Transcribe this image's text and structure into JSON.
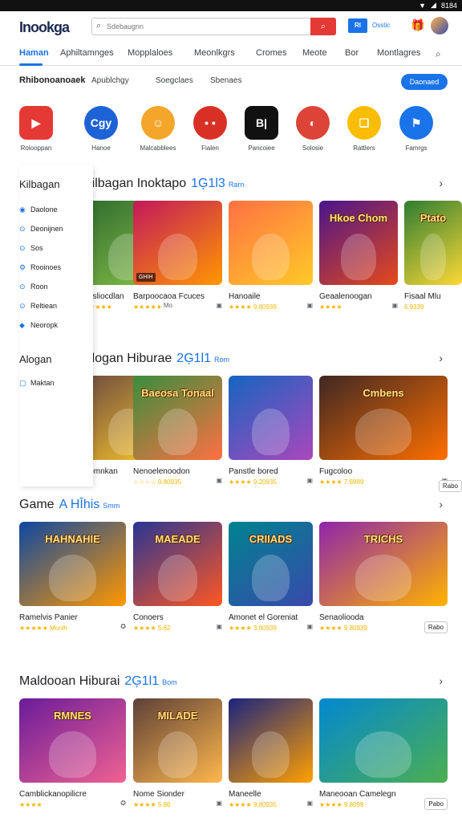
{
  "status": {
    "time": "8184"
  },
  "header": {
    "logo": "Inookga",
    "logo_accent": "#2e7d32",
    "search_placeholder": "Sdebaugnn",
    "partner_tag": "Rl",
    "partner_label": "Osstic",
    "brand_color": "#1a73e8",
    "search_button_color": "#e53935"
  },
  "nav": {
    "tabs": [
      "Haman",
      "Aphiltamnges",
      "Mopplaloes",
      "Meonlkgrs",
      "Cromes",
      "Meote",
      "Bor",
      "Montlagres"
    ]
  },
  "chips": {
    "items": [
      "Rhibonoanoaek",
      "Apublchgy",
      "Soegclaes",
      "Sbenaes"
    ],
    "pill": "Daonaed"
  },
  "apps": [
    {
      "label": "Rolooppan",
      "icon": "play-icon",
      "color": "#e53935",
      "glyph": "▶"
    },
    {
      "label": "Hanoe",
      "icon": "chat-icon",
      "color": "#1e63d6",
      "glyph": "Cgy"
    },
    {
      "label": "Malcabblees",
      "icon": "character-icon",
      "color": "#f4a62a",
      "glyph": "☺"
    },
    {
      "label": "Fialen",
      "icon": "face-icon",
      "color": "#d93025",
      "glyph": "• •"
    },
    {
      "label": "Pancoiee",
      "icon": "box-icon",
      "color": "#111111",
      "glyph": "B|"
    },
    {
      "label": "Solosie",
      "icon": "chrome-icon",
      "color": "#db4437",
      "glyph": "◐"
    },
    {
      "label": "Rattlers",
      "icon": "note-icon",
      "color": "#fbbc04",
      "glyph": "❏"
    },
    {
      "label": "Famrgs",
      "icon": "flag-icon",
      "color": "#1a73e8",
      "glyph": "⚑"
    }
  ],
  "panel": {
    "title1": "Kilbagan",
    "items": [
      {
        "label": "Daolone",
        "icon": "user-icon"
      },
      {
        "label": "Deonijnen",
        "icon": "pin-icon"
      },
      {
        "label": "Sos",
        "icon": "pin-icon"
      },
      {
        "label": "Rooinoes",
        "icon": "gear-icon"
      },
      {
        "label": "Roon",
        "icon": "pin-icon"
      },
      {
        "label": "Reltiean",
        "icon": "pin-icon"
      },
      {
        "label": "Neoropk",
        "icon": "leaf-icon"
      }
    ],
    "title2": "Alogan",
    "item2": "Maktan"
  },
  "sections": [
    {
      "title": "Kilbagan Inoktapo",
      "num": "1Ģ1l3",
      "small": "Rarn",
      "cards": [
        {
          "title": "Fasliocdlan",
          "stars": "★★★★★",
          "meta": "Mo",
          "badge": "",
          "price": "",
          "c1": "#2e6b2e",
          "c2": "#8bc34a"
        },
        {
          "title": "Barpoocaoa Fcuces",
          "stars": "★★★★★",
          "meta": "▣",
          "badge": "GHIH",
          "price": "",
          "c1": "#c2185b",
          "c2": "#ff9800"
        },
        {
          "title": "Hanoaile",
          "stars": "★★★★ 9.80939",
          "meta": "▣",
          "badge": "",
          "price": "",
          "c1": "#ff7043",
          "c2": "#ffca28"
        },
        {
          "title": "Geaalenoogan",
          "stars": "★★★★",
          "meta": "▣",
          "badge": "",
          "price": "",
          "c1": "#4a148c",
          "c2": "#e64a19",
          "tt": "Hkoe Chom"
        },
        {
          "title": "Fisaal Mlu",
          "stars": "6.9339",
          "meta": "",
          "badge": "",
          "price": "",
          "c1": "#2e7d32",
          "c2": "#fdd835",
          "tt": "Ptato"
        }
      ]
    },
    {
      "title": "Alogan Hiburae",
      "num": "2Ģ1l1",
      "small": "Rom",
      "cards": [
        {
          "title": "Nomnkan",
          "stars": "",
          "meta": "",
          "badge": "",
          "price": "",
          "c1": "#6d4c41",
          "c2": "#ffca28"
        },
        {
          "title": "Nenoelenoodon",
          "stars": "☆☆☆☆ 9.80935",
          "meta": "▣",
          "badge": "",
          "price": "",
          "c1": "#388e3c",
          "c2": "#ff7043",
          "tt": "Baeosa Tonaal"
        },
        {
          "title": "Panstle bored",
          "stars": "★★★★ 9.20935",
          "meta": "▣",
          "badge": "",
          "price": "",
          "c1": "#1565c0",
          "c2": "#ab47bc"
        },
        {
          "title": "Fugcoloo",
          "stars": "★★★★ 7.6989",
          "meta": "▣",
          "badge": "",
          "price": "",
          "c1": "#3e2723",
          "c2": "#ff6f00",
          "tt": "Cmbens"
        },
        {
          "title": "",
          "stars": "",
          "meta": "",
          "badge": "",
          "price": "Rabo",
          "c1": "#fff",
          "c2": "#fff"
        }
      ]
    },
    {
      "title": "Game",
      "num": "A HĪhis",
      "small": "Smm",
      "cards": [
        {
          "title": "Ramelvis Panier",
          "stars": "★★★★★ Monlh",
          "meta": "✪",
          "badge": "",
          "price": "",
          "c1": "#0d47a1",
          "c2": "#ff9800",
          "tt": "HAHNAHIE"
        },
        {
          "title": "Conoers",
          "stars": "★★★★ 5.62",
          "meta": "▣",
          "badge": "",
          "price": "",
          "c1": "#283593",
          "c2": "#ff5722",
          "tt": "MAEADE"
        },
        {
          "title": "Amonet el Goreniat",
          "stars": "★★★★ 3.80939",
          "meta": "▣",
          "badge": "",
          "price": "",
          "c1": "#00838f",
          "c2": "#3949ab",
          "tt": "CRIIADS"
        },
        {
          "title": "Senaoliooda",
          "stars": "★★★★ 9.80939",
          "meta": "▣",
          "badge": "",
          "price": "Rabo",
          "c1": "#8e24aa",
          "c2": "#ffb300",
          "tt": "TRICHS"
        }
      ]
    },
    {
      "title": "Maldooan Hiburai",
      "num": "2Ģ1l1",
      "small": "Bom",
      "cards": [
        {
          "title": "Camblickanopilicre",
          "stars": "★★★★",
          "meta": "✪",
          "badge": "",
          "price": "",
          "c1": "#6a1b9a",
          "c2": "#f06292",
          "tt": "RMNES"
        },
        {
          "title": "Nome Sionder",
          "stars": "★★★★ 5.80",
          "meta": "▣",
          "badge": "",
          "price": "",
          "c1": "#5d4037",
          "c2": "#ffb74d",
          "tt": "MILADE"
        },
        {
          "title": "Maneelle",
          "stars": "★★★★ 9.80935",
          "meta": "▣",
          "badge": "",
          "price": "",
          "c1": "#1a237e",
          "c2": "#ffa000"
        },
        {
          "title": "Maneooan Camelegn",
          "stars": "★★★★ 9.8099",
          "meta": "▣",
          "badge": "",
          "price": "Pabo",
          "c1": "#0288d1",
          "c2": "#4caf50"
        }
      ]
    }
  ]
}
